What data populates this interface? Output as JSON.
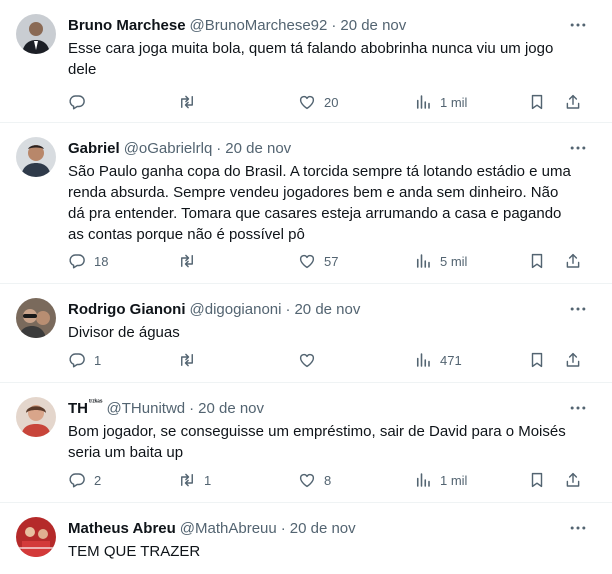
{
  "tweets": [
    {
      "name": "Bruno Marchese",
      "name_sup": "",
      "handle": "@BrunoMarchese92",
      "time": "20 de nov",
      "text": "Esse cara joga muita bola, quem tá falando abobrinha nunca viu um jogo\ndele",
      "replies": "",
      "retweets": "",
      "likes": "20",
      "views": "1 mil"
    },
    {
      "name": "Gabriel",
      "name_sup": "",
      "handle": "@oGabrielrlq",
      "time": "20 de nov",
      "text": "São Paulo ganha copa do Brasil. A torcida sempre tá lotando estádio e uma\nrenda absurda. Sempre vendeu jogadores bem e anda sem dinheiro. Não\ndá pra entender. Tomara que casares esteja arrumando a casa e pagando\nas contas porque não é possível pô",
      "replies": "18",
      "retweets": "",
      "likes": "57",
      "views": "5 mil"
    },
    {
      "name": "Rodrigo Gianoni",
      "name_sup": "",
      "handle": "@digogianoni",
      "time": "20 de nov",
      "text": "Divisor de águas",
      "replies": "1",
      "retweets": "",
      "likes": "",
      "views": "471"
    },
    {
      "name": "TH",
      "name_sup": "ᵗʳᶻᵏᵃˢ",
      "handle": "@THunitwd",
      "time": "20 de nov",
      "text": "Bom jogador, se conseguisse um empréstimo, sair de David para o Moisés\nseria um baita up",
      "replies": "2",
      "retweets": "1",
      "likes": "8",
      "views": "1 mil"
    },
    {
      "name": "Matheus Abreu",
      "name_sup": "",
      "handle": "@MathAbreuu",
      "time": "20 de nov",
      "text": "TEM QUE TRAZER",
      "replies": "",
      "retweets": "",
      "likes": "",
      "views": ""
    }
  ],
  "separator": "·",
  "icons": {
    "more": "more-icon",
    "reply": "reply-icon",
    "retweet": "retweet-icon",
    "like": "like-icon",
    "views": "views-icon",
    "bookmark": "bookmark-icon",
    "share": "share-icon"
  },
  "colors": {
    "text": "#0f1419",
    "muted": "#536471",
    "divider": "#eff3f4"
  }
}
